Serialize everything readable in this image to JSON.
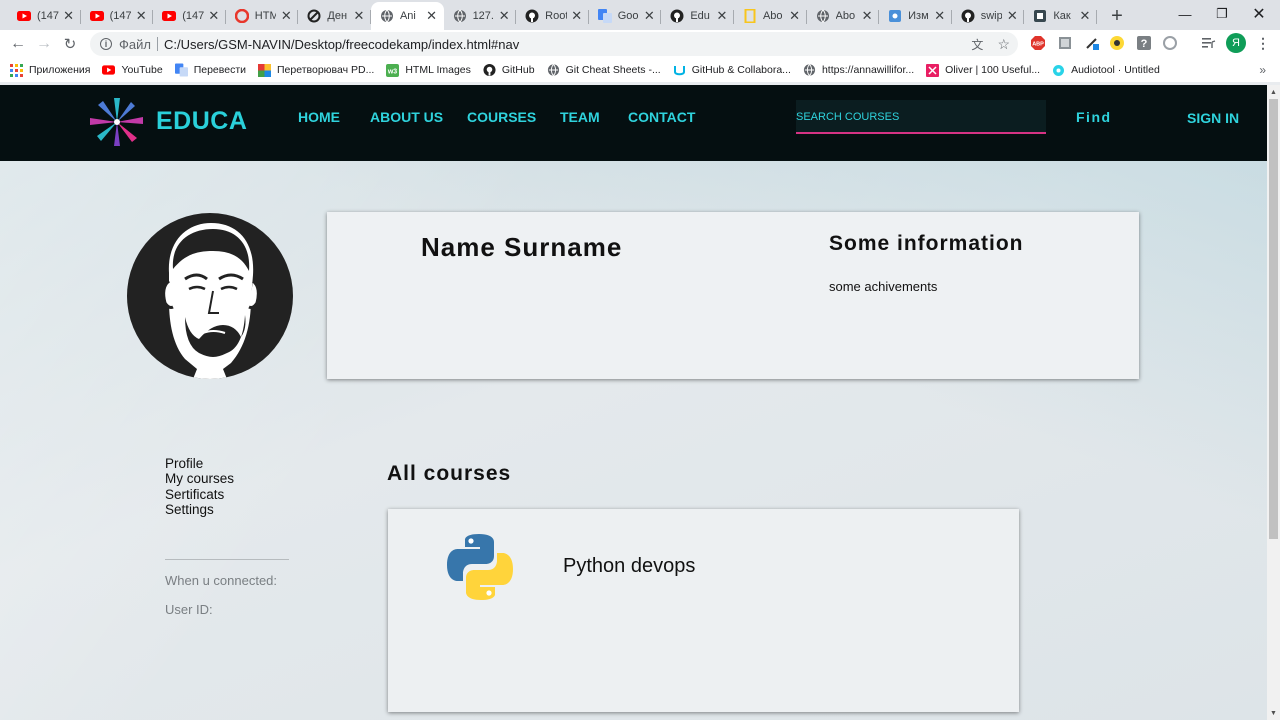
{
  "browser": {
    "tabs": [
      {
        "title": "(147",
        "icon": "youtube-icon",
        "color": "#ff0000"
      },
      {
        "title": "(147",
        "icon": "youtube-icon",
        "color": "#ff0000"
      },
      {
        "title": "(147",
        "icon": "youtube-icon",
        "color": "#ff0000"
      },
      {
        "title": "HTM",
        "icon": "opera-icon",
        "color": "#e8372c"
      },
      {
        "title": "Ден",
        "icon": "circle-slash-icon",
        "color": "#222222"
      },
      {
        "title": "Ani",
        "icon": "globe-icon",
        "color": "#5f6368",
        "active": true
      },
      {
        "title": "127.",
        "icon": "globe-icon",
        "color": "#5f6368"
      },
      {
        "title": "Root",
        "icon": "github-icon",
        "color": "#222222"
      },
      {
        "title": "Goo",
        "icon": "translate-icon",
        "color": "#4285f4"
      },
      {
        "title": "Edu",
        "icon": "github-icon",
        "color": "#222222"
      },
      {
        "title": "Abo",
        "icon": "natgeo-icon",
        "color": "#f8c51c"
      },
      {
        "title": "Abo",
        "icon": "globe-icon",
        "color": "#5f6368"
      },
      {
        "title": "Изм",
        "icon": "puzzle-icon",
        "color": "#4a90d9"
      },
      {
        "title": "swip",
        "icon": "github-icon",
        "color": "#222222"
      },
      {
        "title": "Как",
        "icon": "book-icon",
        "color": "#37474f"
      }
    ],
    "address": {
      "scheme": "Файл",
      "url": "C:/Users/GSM-NAVIN/Desktop/freecodekamp/index.html#nav"
    },
    "profile_letter": "Я",
    "bookmarks": [
      {
        "label": "Приложения",
        "icon": "apps-grid-icon",
        "color": "#e94235"
      },
      {
        "label": "YouTube",
        "icon": "youtube-icon",
        "color": "#ff0000"
      },
      {
        "label": "Перевести",
        "icon": "translate-icon",
        "color": "#4285f4"
      },
      {
        "label": "Перетворювач PD...",
        "icon": "color-grid-icon",
        "color": "#e53935"
      },
      {
        "label": "HTML Images",
        "icon": "w3-icon",
        "color": "#4caf50"
      },
      {
        "label": "GitHub",
        "icon": "github-icon",
        "color": "#222222"
      },
      {
        "label": "Git Cheat Sheets -...",
        "icon": "globe-icon",
        "color": "#5f6368"
      },
      {
        "label": "GitHub & Collabora...",
        "icon": "udacity-icon",
        "color": "#02b3e4"
      },
      {
        "label": "https://annawillifor...",
        "icon": "globe-icon",
        "color": "#5f6368"
      },
      {
        "label": "Oliver | 100 Useful...",
        "icon": "design-icon",
        "color": "#e91e63"
      },
      {
        "label": "Audiotool · Untitled",
        "icon": "audiotool-icon",
        "color": "#29d3e8"
      }
    ]
  },
  "site": {
    "brand": "EDUCA",
    "nav": [
      "HOME",
      "ABOUT US",
      "COURSES",
      "TEAM",
      "CONTACT"
    ],
    "search_placeholder": "SEARCH COURSES",
    "find_label": "Find",
    "signin_label": "SIGN IN",
    "accent_color": "#2fd3dd",
    "header_color": "#050f11"
  },
  "profile": {
    "name": "Name Surname",
    "info_title": "Some information",
    "info_text": "some achivements"
  },
  "sidebar": {
    "items": [
      "Profile",
      "My courses",
      "Sertificats",
      "Settings"
    ],
    "connected_label": "When u connected:",
    "user_id_label": "User ID:"
  },
  "courses": {
    "heading": "All courses",
    "items": [
      {
        "name": "Python devops",
        "icon": "python-icon"
      }
    ]
  }
}
